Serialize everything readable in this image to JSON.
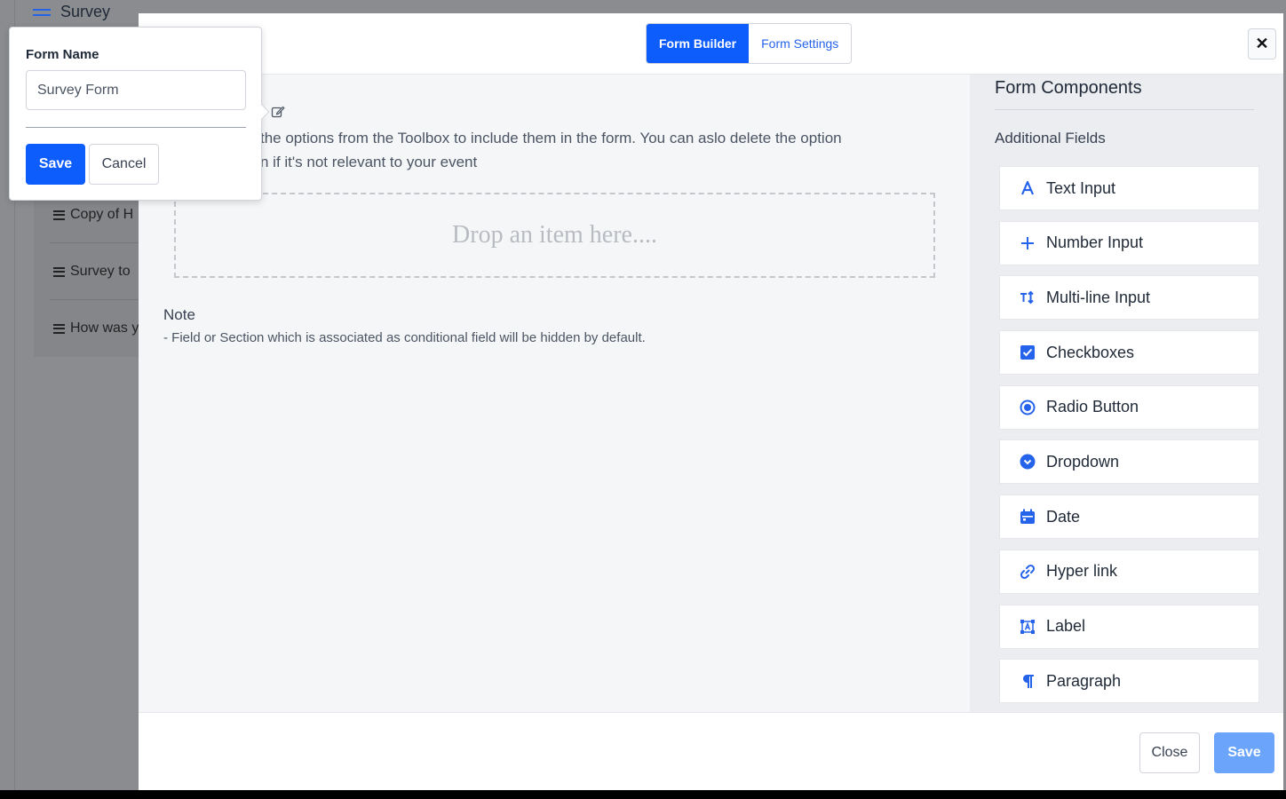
{
  "background": {
    "title": "Survey",
    "list_items": [
      {
        "label": "Copy of H"
      },
      {
        "label": "Survey to"
      },
      {
        "label": "How was y"
      }
    ]
  },
  "modal": {
    "tabs": [
      {
        "label": "Form Builder",
        "active": true
      },
      {
        "label": "Form Settings",
        "active": false
      }
    ],
    "close_glyph": "✕",
    "builder": {
      "intro_line1": "the options from the Toolbox to include them in the form. You can aslo delete the option",
      "intro_line2": "n if it's not relevant to your event",
      "drop_placeholder": "Drop an item here....",
      "note_title": "Note",
      "note_text": "- Field or Section which is associated as conditional field will be hidden by default."
    },
    "components": {
      "title": "Form Components",
      "subtitle": "Additional Fields",
      "items": [
        {
          "label": "Text Input",
          "icon": "text-input-icon"
        },
        {
          "label": "Number Input",
          "icon": "plus-icon"
        },
        {
          "label": "Multi-line Input",
          "icon": "multiline-icon"
        },
        {
          "label": "Checkboxes",
          "icon": "checkbox-icon"
        },
        {
          "label": "Radio Button",
          "icon": "radio-icon"
        },
        {
          "label": "Dropdown",
          "icon": "dropdown-icon"
        },
        {
          "label": "Date",
          "icon": "calendar-icon"
        },
        {
          "label": "Hyper link",
          "icon": "link-icon"
        },
        {
          "label": "Label",
          "icon": "label-icon"
        },
        {
          "label": "Paragraph",
          "icon": "paragraph-icon"
        }
      ]
    },
    "footer": {
      "close_label": "Close",
      "save_label": "Save"
    }
  },
  "popover": {
    "label": "Form Name",
    "input_value": "Survey Form",
    "save_label": "Save",
    "cancel_label": "Cancel"
  },
  "colors": {
    "primary": "#0d5dfc",
    "primary_disabled": "#6aa4fb",
    "icon_blue": "#2563eb"
  }
}
